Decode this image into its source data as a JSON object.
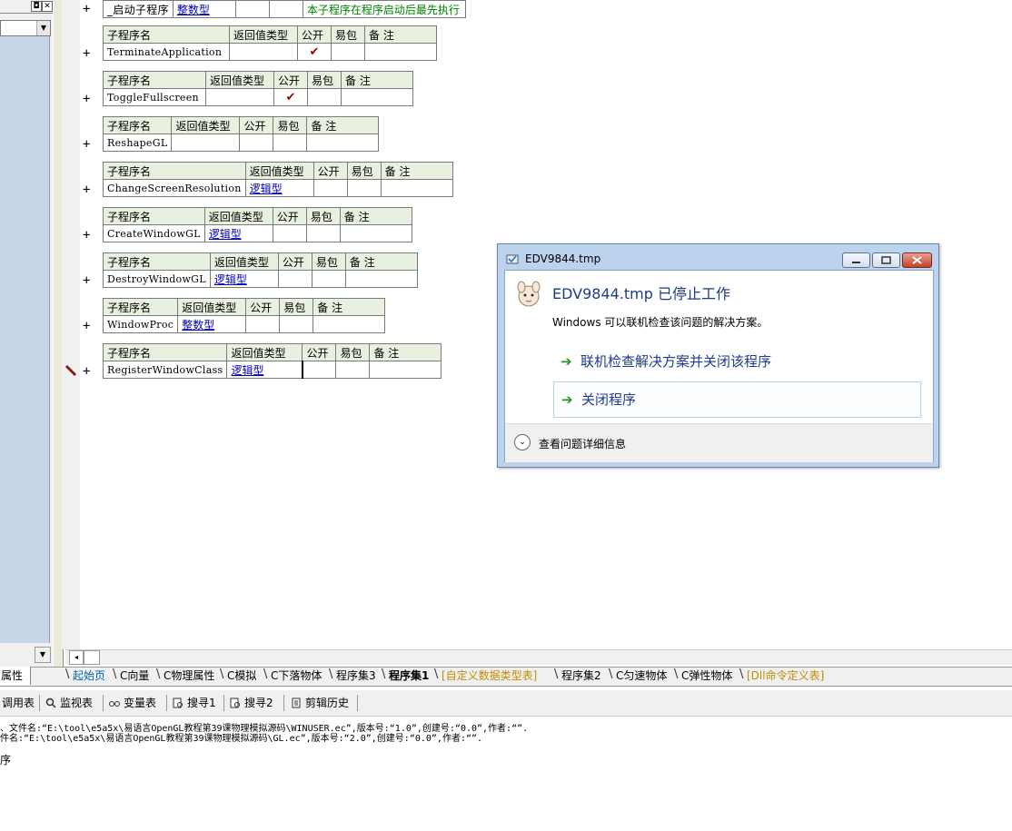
{
  "left_panel": {
    "restore_glyph": "◘",
    "close_glyph": "✕",
    "combo_arrow": "▼",
    "scroll_down_arrow": "▼"
  },
  "top_row": {
    "name": "_启动子程序",
    "type": "整数型",
    "remark": "本子程序在程序启动后最先执行"
  },
  "headers": {
    "name": "子程序名",
    "return_type": "返回值类型",
    "public": "公开",
    "easy_pack": "易包",
    "remark": "备 注"
  },
  "plus_glyph": "+",
  "check_glyph": "✔",
  "subroutines": [
    {
      "name": "TerminateApplication",
      "type": "",
      "public": true
    },
    {
      "name": "ToggleFullscreen",
      "type": "",
      "public": true
    },
    {
      "name": "ReshapeGL",
      "type": "",
      "public": false
    },
    {
      "name": "ChangeScreenResolution",
      "type": "逻辑型",
      "public": false
    },
    {
      "name": "CreateWindowGL",
      "type": "逻辑型",
      "public": false
    },
    {
      "name": "DestroyWindowGL",
      "type": "逻辑型",
      "public": false
    },
    {
      "name": "WindowProc",
      "type": "整数型",
      "public": false
    },
    {
      "name": "RegisterWindowClass",
      "type": "逻辑型",
      "public": false
    }
  ],
  "hscroll": {
    "left_arrow": "◂"
  },
  "tabs": {
    "properties": "属性",
    "items": [
      {
        "label": "起始页",
        "kind": "start"
      },
      {
        "label": "C向量",
        "kind": "normal"
      },
      {
        "label": "C物理属性",
        "kind": "normal"
      },
      {
        "label": "C模拟",
        "kind": "normal"
      },
      {
        "label": "C下落物体",
        "kind": "normal"
      },
      {
        "label": "程序集3",
        "kind": "normal"
      },
      {
        "label": "程序集1",
        "kind": "active"
      },
      {
        "label": "[自定义数据类型表]",
        "kind": "special"
      },
      {
        "label": "程序集2",
        "kind": "normal"
      },
      {
        "label": "C匀速物体",
        "kind": "normal"
      },
      {
        "label": "C弹性物体",
        "kind": "normal"
      },
      {
        "label": "[Dll命令定义表]",
        "kind": "special"
      }
    ]
  },
  "bottom_toolbar": {
    "call_table": "调用表",
    "watch_table": "监视表",
    "var_table": "变量表",
    "search1": "搜寻1",
    "search2": "搜寻2",
    "clip_history": "剪辑历史"
  },
  "output": {
    "line1": "、文件名:“E:\\tool\\e5a5x\\易语言OpenGL教程第39课物理模拟源码\\WINUSER.ec”,版本号:“1.0”,创建号:“0.0”,作者:“”.",
    "line2": "件名:“E:\\tool\\e5a5x\\易语言OpenGL教程第39课物理模拟源码\\GL.ec”,版本号:“2.0”,创建号:“0.0”,作者:“”.",
    "line3": "序"
  },
  "dialog": {
    "title": "EDV9844.tmp",
    "heading": "EDV9844.tmp 已停止工作",
    "description": "Windows 可以联机检查该问题的解决方案。",
    "option_check": "联机检查解决方案并关闭该程序",
    "option_close": "关闭程序",
    "details": "查看问题详细信息",
    "arrow_glyph": "➔",
    "chevron_glyph": "⌄"
  },
  "colors": {
    "type_link": "#0000b0",
    "header_bg": "#e8f0e0",
    "remark_green": "#008000",
    "dialog_heading": "#1e3a8a",
    "special_tab": "#c28b00"
  }
}
